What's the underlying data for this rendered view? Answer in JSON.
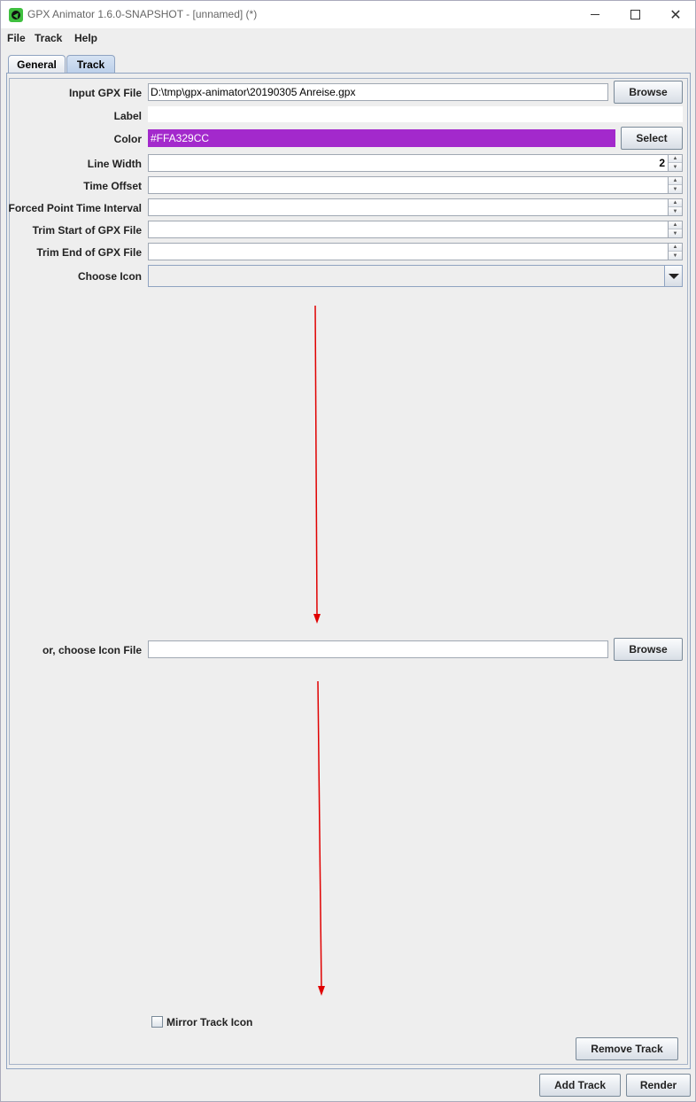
{
  "window": {
    "title": "GPX Animator 1.6.0-SNAPSHOT - [unnamed] (*)",
    "close_glyph": "✕"
  },
  "menu": {
    "file": "File",
    "track": "Track",
    "help": "Help"
  },
  "tabs": {
    "general": "General",
    "track": "Track"
  },
  "form": {
    "input_gpx_label": "Input GPX File",
    "input_gpx_value": "D:\\tmp\\gpx-animator\\20190305 Anreise.gpx",
    "browse_label": "Browse",
    "label_label": "Label",
    "label_value": "",
    "color_label": "Color",
    "color_value": "#FFA329CC",
    "color_swatch": "#a329cc",
    "select_label": "Select",
    "line_width_label": "Line Width",
    "line_width_value": "2",
    "time_offset_label": "Time Offset",
    "forced_interval_label": "Forced Point Time Interval",
    "trim_start_label": "Trim Start of GPX File",
    "trim_end_label": "Trim End of GPX File",
    "choose_icon_label": "Choose Icon",
    "icon_file_label": "or, choose Icon File",
    "icon_file_value": "",
    "icon_browse_label": "Browse",
    "mirror_label": "Mirror Track Icon",
    "remove_track_label": "Remove Track"
  },
  "footer": {
    "add_track": "Add Track",
    "render": "Render"
  },
  "annotation_color": "#e00000"
}
